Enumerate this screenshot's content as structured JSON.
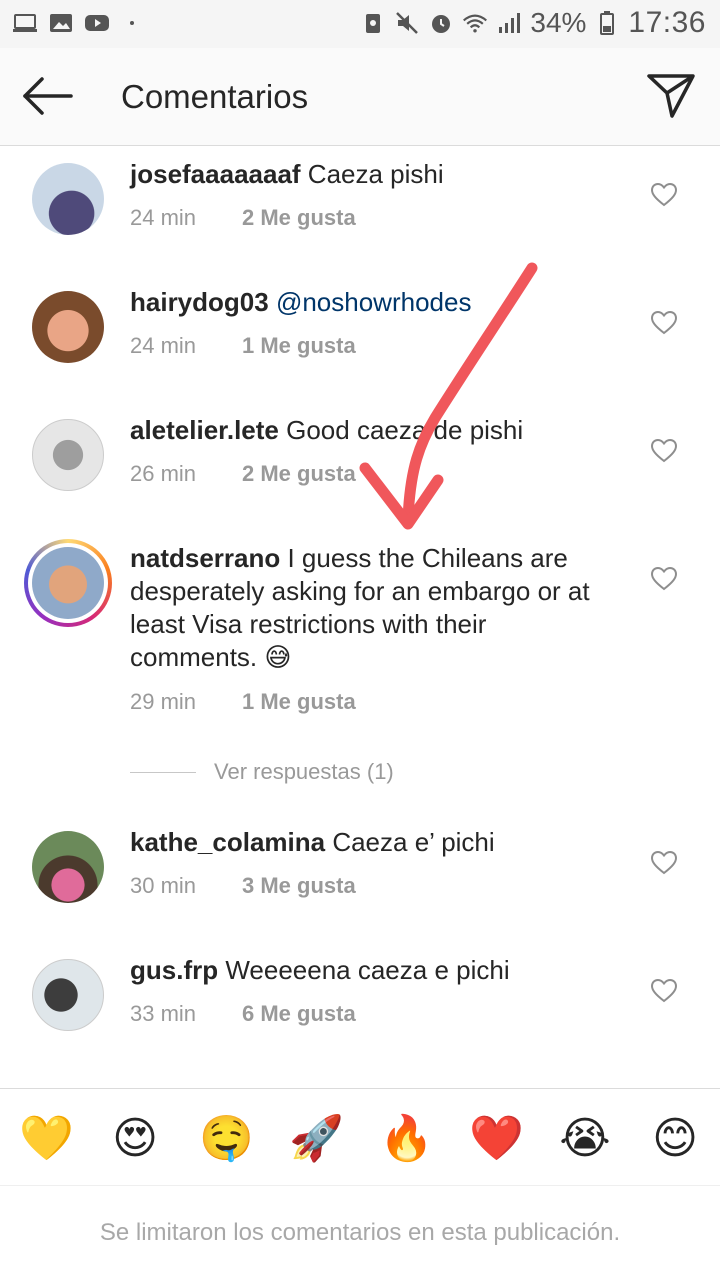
{
  "status_bar": {
    "battery": "34%",
    "time": "17:36"
  },
  "header": {
    "title": "Comentarios"
  },
  "comments": [
    {
      "username": "josefaaaaaaaf",
      "text": " Caeza pishi",
      "time": "24 min",
      "likes": "2 Me gusta",
      "avatar_color": "#c9d7e6"
    },
    {
      "username": "hairydog03",
      "mention": " @noshowrhodes",
      "text": "",
      "time": "24 min",
      "likes": "1 Me gusta",
      "avatar_color": "#b07a55"
    },
    {
      "username": "aletelier.lete",
      "text": " Good caeza de pishi",
      "time": "26 min",
      "likes": "2 Me gusta",
      "avatar_color": "#d9d9d9"
    },
    {
      "username": "natdserrano",
      "text": " I guess the Chileans are desperately asking for an embargo or at least Visa restrictions with their comments. 😅",
      "time": "29 min",
      "likes": "1 Me gusta",
      "avatar_color": "#8fa9c9",
      "replies": "Ver respuestas (1)"
    },
    {
      "username": "kathe_colamina",
      "text": " Caeza e’ pichi",
      "time": "30 min",
      "likes": "3 Me gusta",
      "avatar_color": "#6b8a5a"
    },
    {
      "username": "gus.frp",
      "text": " Weeeeena caeza e pichi",
      "time": "33 min",
      "likes": "6 Me gusta",
      "avatar_color": "#cfd8dc"
    }
  ],
  "emoji_bar": [
    "💛",
    "😍",
    "🤤",
    "🚀",
    "🔥",
    "❤️",
    "😭",
    "😊"
  ],
  "footer": {
    "text": "Se limitaron los comentarios en esta publicación."
  },
  "colors": {
    "accent_arrow": "#f0575b",
    "mention": "#003569",
    "meta": "#999999"
  }
}
